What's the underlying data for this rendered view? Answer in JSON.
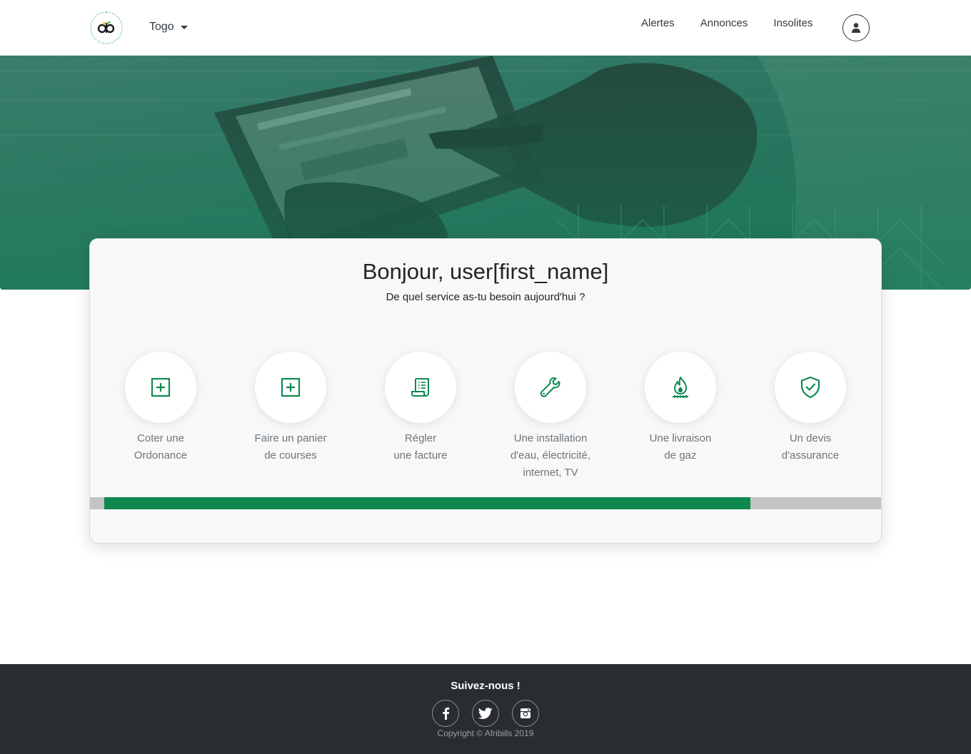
{
  "header": {
    "country": "Togo",
    "nav": [
      "Alertes",
      "Annonces",
      "Insolites"
    ],
    "logo_icon": "afribills-logo",
    "user_icon": "user-icon"
  },
  "main": {
    "greeting": "Bonjour, user[first_name]",
    "subtitle": "De quel service as-tu besoin aujourd'hui ?",
    "services": [
      {
        "label": "Coter une\nOrdonance",
        "icon": "plus-square-icon"
      },
      {
        "label": "Faire un panier\nde courses",
        "icon": "plus-square-icon"
      },
      {
        "label": "Régler\nune facture",
        "icon": "receipt-icon"
      },
      {
        "label": "Une installation\nd'eau, électricité,\ninternet, TV",
        "icon": "wrench-icon"
      },
      {
        "label": "Une livraison\nde gaz",
        "icon": "gas-flame-icon"
      },
      {
        "label": "Un devis\nd'assurance",
        "icon": "shield-check-icon"
      }
    ],
    "progress": 0.847
  },
  "footer": {
    "title": "Suivez-nous !",
    "socials": [
      "facebook-icon",
      "twitter-icon",
      "instagram-icon"
    ],
    "copyright": "Copyright © Afribills 2019"
  },
  "colors": {
    "accent": "#0f8a4e",
    "footer_bg": "#292d31",
    "hero_tint": "#1f7a5c"
  }
}
